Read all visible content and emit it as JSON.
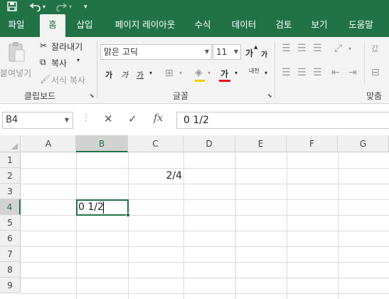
{
  "quick_access": {
    "icons": [
      "save-icon",
      "undo-icon",
      "redo-icon",
      "customize-icon"
    ]
  },
  "tabs": [
    {
      "label": "파일",
      "active": false
    },
    {
      "label": "홈",
      "active": true
    },
    {
      "label": "삽입",
      "active": false
    },
    {
      "label": "페이지 레이아웃",
      "active": false
    },
    {
      "label": "수식",
      "active": false
    },
    {
      "label": "데이터",
      "active": false
    },
    {
      "label": "검토",
      "active": false
    },
    {
      "label": "보기",
      "active": false
    },
    {
      "label": "도움말",
      "active": false
    }
  ],
  "ribbon": {
    "clipboard": {
      "paste_label": "붙여넣기",
      "cut_label": "잘라내기",
      "copy_label": "복사",
      "format_painter_label": "서식 복사",
      "group_label": "클립보드"
    },
    "font": {
      "font_name": "맑은 고딕",
      "font_size": "11",
      "grow_glyph": "가",
      "shrink_glyph": "가",
      "bold_glyph": "가",
      "italic_glyph": "가",
      "underline_glyph": "가",
      "font_color_glyph": "가",
      "phonetic_glyph": "내천",
      "group_label": "글꼴"
    },
    "alignment": {
      "group_label": "맞춤",
      "wrap_glyph": "갔"
    }
  },
  "formula_bar": {
    "name_box": "B4",
    "cancel_icon": "✕",
    "enter_icon": "✓",
    "fx_label": "fx",
    "content": "0 1/2"
  },
  "grid": {
    "columns": [
      "A",
      "B",
      "C",
      "D",
      "E",
      "F",
      "G"
    ],
    "rows": [
      "1",
      "2",
      "3",
      "4",
      "5",
      "6",
      "7",
      "8",
      "9"
    ],
    "selected_column": "B",
    "selected_row": "4",
    "cells": {
      "C2": "2/4",
      "B4": "0 1/2"
    }
  },
  "colors": {
    "accent": "#217346",
    "ribbon_bg": "#f3f3f3",
    "font_color_bar": "#e81123"
  }
}
